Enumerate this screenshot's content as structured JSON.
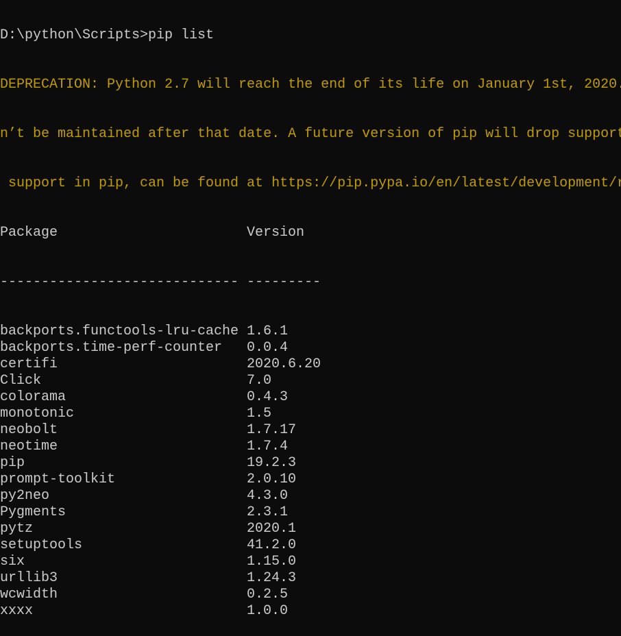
{
  "colors": {
    "background": "#0c0c0c",
    "text": "#cccccc",
    "warning": "#c19c00"
  },
  "prompt": "D:\\python\\Scripts>pip list",
  "deprecation": [
    "DEPRECATION: Python 2.7 will reach the end of its life on January 1st, 2020.",
    "n’t be maintained after that date. A future version of pip will drop support",
    " support in pip, can be found at https://pip.pypa.io/en/latest/development/r"
  ],
  "header": {
    "package": "Package",
    "version": "Version",
    "sep_package": "-----------------------------",
    "sep_version": "---------"
  },
  "packages": [
    {
      "name": "backports.functools-lru-cache",
      "version": "1.6.1"
    },
    {
      "name": "backports.time-perf-counter",
      "version": "0.0.4"
    },
    {
      "name": "certifi",
      "version": "2020.6.20"
    },
    {
      "name": "Click",
      "version": "7.0"
    },
    {
      "name": "colorama",
      "version": "0.4.3"
    },
    {
      "name": "monotonic",
      "version": "1.5"
    },
    {
      "name": "neobolt",
      "version": "1.7.17"
    },
    {
      "name": "neotime",
      "version": "1.7.4"
    },
    {
      "name": "pip",
      "version": "19.2.3"
    },
    {
      "name": "prompt-toolkit",
      "version": "2.0.10"
    },
    {
      "name": "py2neo",
      "version": "4.3.0"
    },
    {
      "name": "Pygments",
      "version": "2.3.1"
    },
    {
      "name": "pytz",
      "version": "2020.1"
    },
    {
      "name": "setuptools",
      "version": "41.2.0"
    },
    {
      "name": "six",
      "version": "1.15.0"
    },
    {
      "name": "urllib3",
      "version": "1.24.3"
    },
    {
      "name": "wcwidth",
      "version": "0.2.5"
    },
    {
      "name": "xxxx",
      "version": "1.0.0"
    }
  ]
}
